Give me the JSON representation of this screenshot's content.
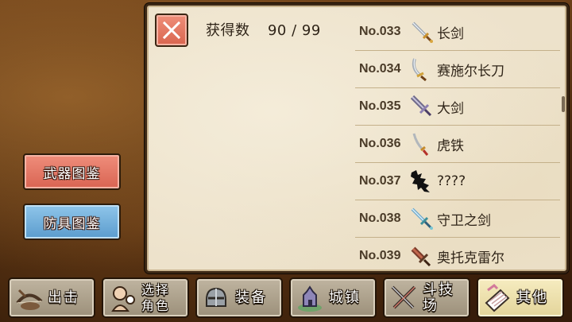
{
  "collection": {
    "count_label": "获得数",
    "count_value": "90 / 99",
    "close_icon": "close-x-icon"
  },
  "items": [
    {
      "no": "No.033",
      "name": "长剑",
      "icon": "long-sword-icon"
    },
    {
      "no": "No.034",
      "name": "赛施尔长刀",
      "icon": "scimitar-icon"
    },
    {
      "no": "No.035",
      "name": "大剑",
      "icon": "great-sword-icon"
    },
    {
      "no": "No.036",
      "name": "虎铁",
      "icon": "katana-icon"
    },
    {
      "no": "No.037",
      "name": "????",
      "icon": "unknown-silhouette-icon"
    },
    {
      "no": "No.038",
      "name": "守卫之剑",
      "icon": "guardian-sword-icon"
    },
    {
      "no": "No.039",
      "name": "奥托克雷尔",
      "icon": "ottoclair-blade-icon"
    }
  ],
  "side_menu": {
    "weapons": "武器图鉴",
    "armor": "防具图鉴"
  },
  "nav": [
    {
      "label": "出击",
      "icon": "sortie-bow-icon",
      "active": false
    },
    {
      "label_line1": "选择",
      "label_line2": "角色",
      "icon": "character-select-icon",
      "active": false
    },
    {
      "label": "装备",
      "icon": "equipment-helmet-icon",
      "active": false
    },
    {
      "label": "城镇",
      "icon": "town-castle-icon",
      "active": false
    },
    {
      "label": "斗技场",
      "icon": "arena-crossed-swords-icon",
      "active": false
    },
    {
      "label": "其他",
      "icon": "other-scroll-icon",
      "active": true
    }
  ],
  "colors": {
    "weapons_button": "#d96452",
    "armor_button": "#5b9ccd",
    "close_button": "#d9654f",
    "active_tab": "#e3d49a",
    "paper": "#ede2cb"
  }
}
